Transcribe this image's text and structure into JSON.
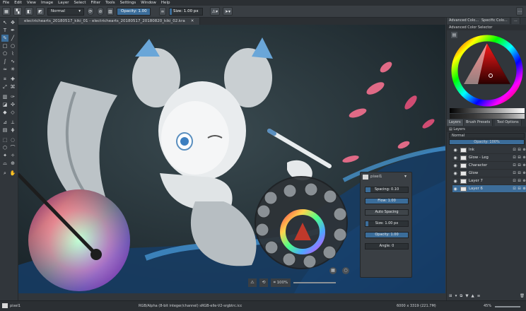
{
  "menu": [
    "File",
    "Edit",
    "View",
    "Image",
    "Layer",
    "Select",
    "Filter",
    "Tools",
    "Settings",
    "Window",
    "Help"
  ],
  "tool_options": {
    "blend_mode": "Normal",
    "opacity_label": "Opacity: 1.00",
    "opacity": 1.0,
    "size_label": "Size: 1.00 px"
  },
  "doc_tab": "electrichearts_20180517_kiki_01 - electrichearts_20180517_20180820_kiki_02.kra",
  "right_dock": {
    "top_tabs": [
      "Advanced Colo...",
      "Specific Colo...",
      "..."
    ],
    "color_selector_title": "Advanced Color Selector",
    "layers_tabs": [
      "Layers",
      "Brush Presets",
      "Tool Options"
    ],
    "layers_title": "Layers",
    "layer_blend": "Normal",
    "layer_opacity": "Opacity:  100%",
    "layers": [
      {
        "name": "Ink",
        "selected": false
      },
      {
        "name": "Glow - Leg",
        "selected": false
      },
      {
        "name": "Character",
        "selected": false
      },
      {
        "name": "Glow",
        "selected": false
      },
      {
        "name": "Layer 7",
        "selected": false
      },
      {
        "name": "Layer 6",
        "selected": true
      }
    ]
  },
  "brush_popup": {
    "title": "pixel1",
    "spacing": "Spacing: 0.10",
    "flow": "Flow: 1.00",
    "auto_spacing": "Auto Spacing",
    "size": "Size: 1.00 px",
    "opacity": "Opacity: 1.00",
    "angle": "Angle: 0"
  },
  "canvas_overlay": {
    "zoom_label": "100%"
  },
  "status": {
    "brush": "pixel1",
    "color_space": "RGB/Alpha (8-bit integer/channel)  sRGB-elle-V2-srgbtrc.icc",
    "dimensions": "6000 x 3319 (221.7M)",
    "zoom": "45%"
  },
  "colors": {
    "accent": "#3b6d9a",
    "selected_row": "#3d6d99",
    "panel": "#31363b"
  }
}
